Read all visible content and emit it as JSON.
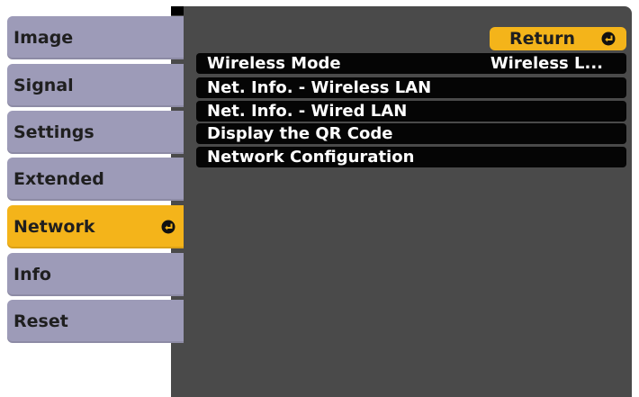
{
  "sidebar": {
    "items": [
      {
        "label": "Image"
      },
      {
        "label": "Signal"
      },
      {
        "label": "Settings"
      },
      {
        "label": "Extended"
      },
      {
        "label": "Network"
      },
      {
        "label": "Info"
      },
      {
        "label": "Reset"
      }
    ],
    "selected_index": 4
  },
  "panel": {
    "return_label": "Return",
    "rows": [
      {
        "label": "Wireless Mode",
        "value": "Wireless L..."
      },
      {
        "label": "Net. Info. - Wireless LAN",
        "value": ""
      },
      {
        "label": "Net. Info. - Wired LAN",
        "value": ""
      },
      {
        "label": "Display the QR Code",
        "value": ""
      },
      {
        "label": "Network Configuration",
        "value": ""
      }
    ]
  },
  "colors": {
    "tab": "#9d9bb8",
    "selected": "#f4b41a",
    "panel": "#4a4a4a",
    "row": "#050505"
  },
  "icons": {
    "enter": "enter-icon"
  }
}
